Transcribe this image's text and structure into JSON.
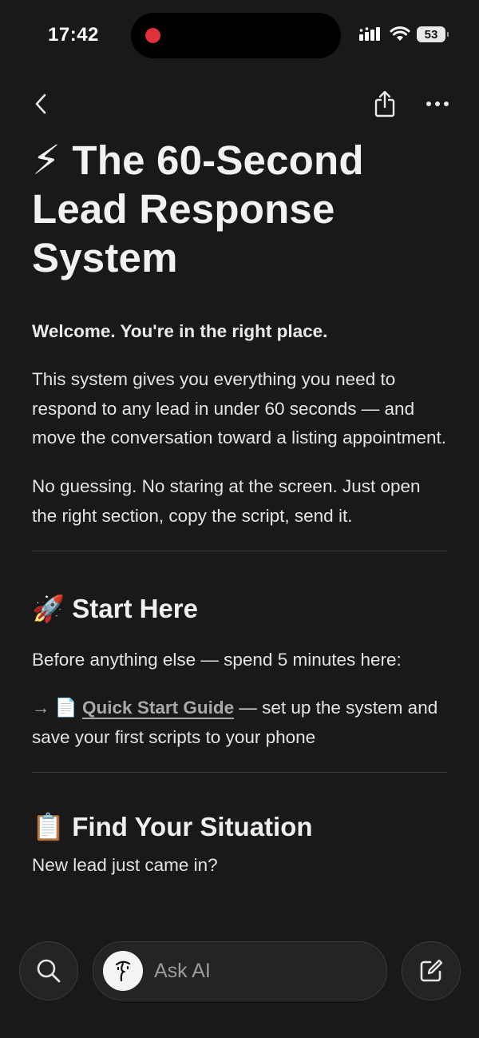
{
  "status_bar": {
    "time": "17:42",
    "battery": "53"
  },
  "page": {
    "title_emoji": "⚡",
    "title": "The 60-Second Lead Response System",
    "welcome": "Welcome. You're in the right place.",
    "intro_1": "This system gives you everything you need to respond to any lead in under 60 seconds — and move the conversation toward a listing appointment.",
    "intro_2": "No guessing. No staring at the screen. Just open the right section, copy the script, send it.",
    "start_emoji": "🚀",
    "start_heading": "Start Here",
    "start_text": "Before anything else — spend 5 minutes here:",
    "quick_arrow": "→",
    "quick_doc_emoji": "📄",
    "quick_link": "Quick Start Guide",
    "quick_rest": " — set up the system and save your first scripts to your phone",
    "find_emoji": "📋",
    "find_heading": "Find Your Situation",
    "new_lead": "New lead just came in?"
  },
  "bottom_bar": {
    "ask_placeholder": "Ask AI"
  },
  "icons": [
    "back-icon",
    "share-icon",
    "more-icon",
    "search-icon",
    "ai-face-icon",
    "compose-icon",
    "signal-icon",
    "wifi-icon",
    "battery-icon"
  ]
}
